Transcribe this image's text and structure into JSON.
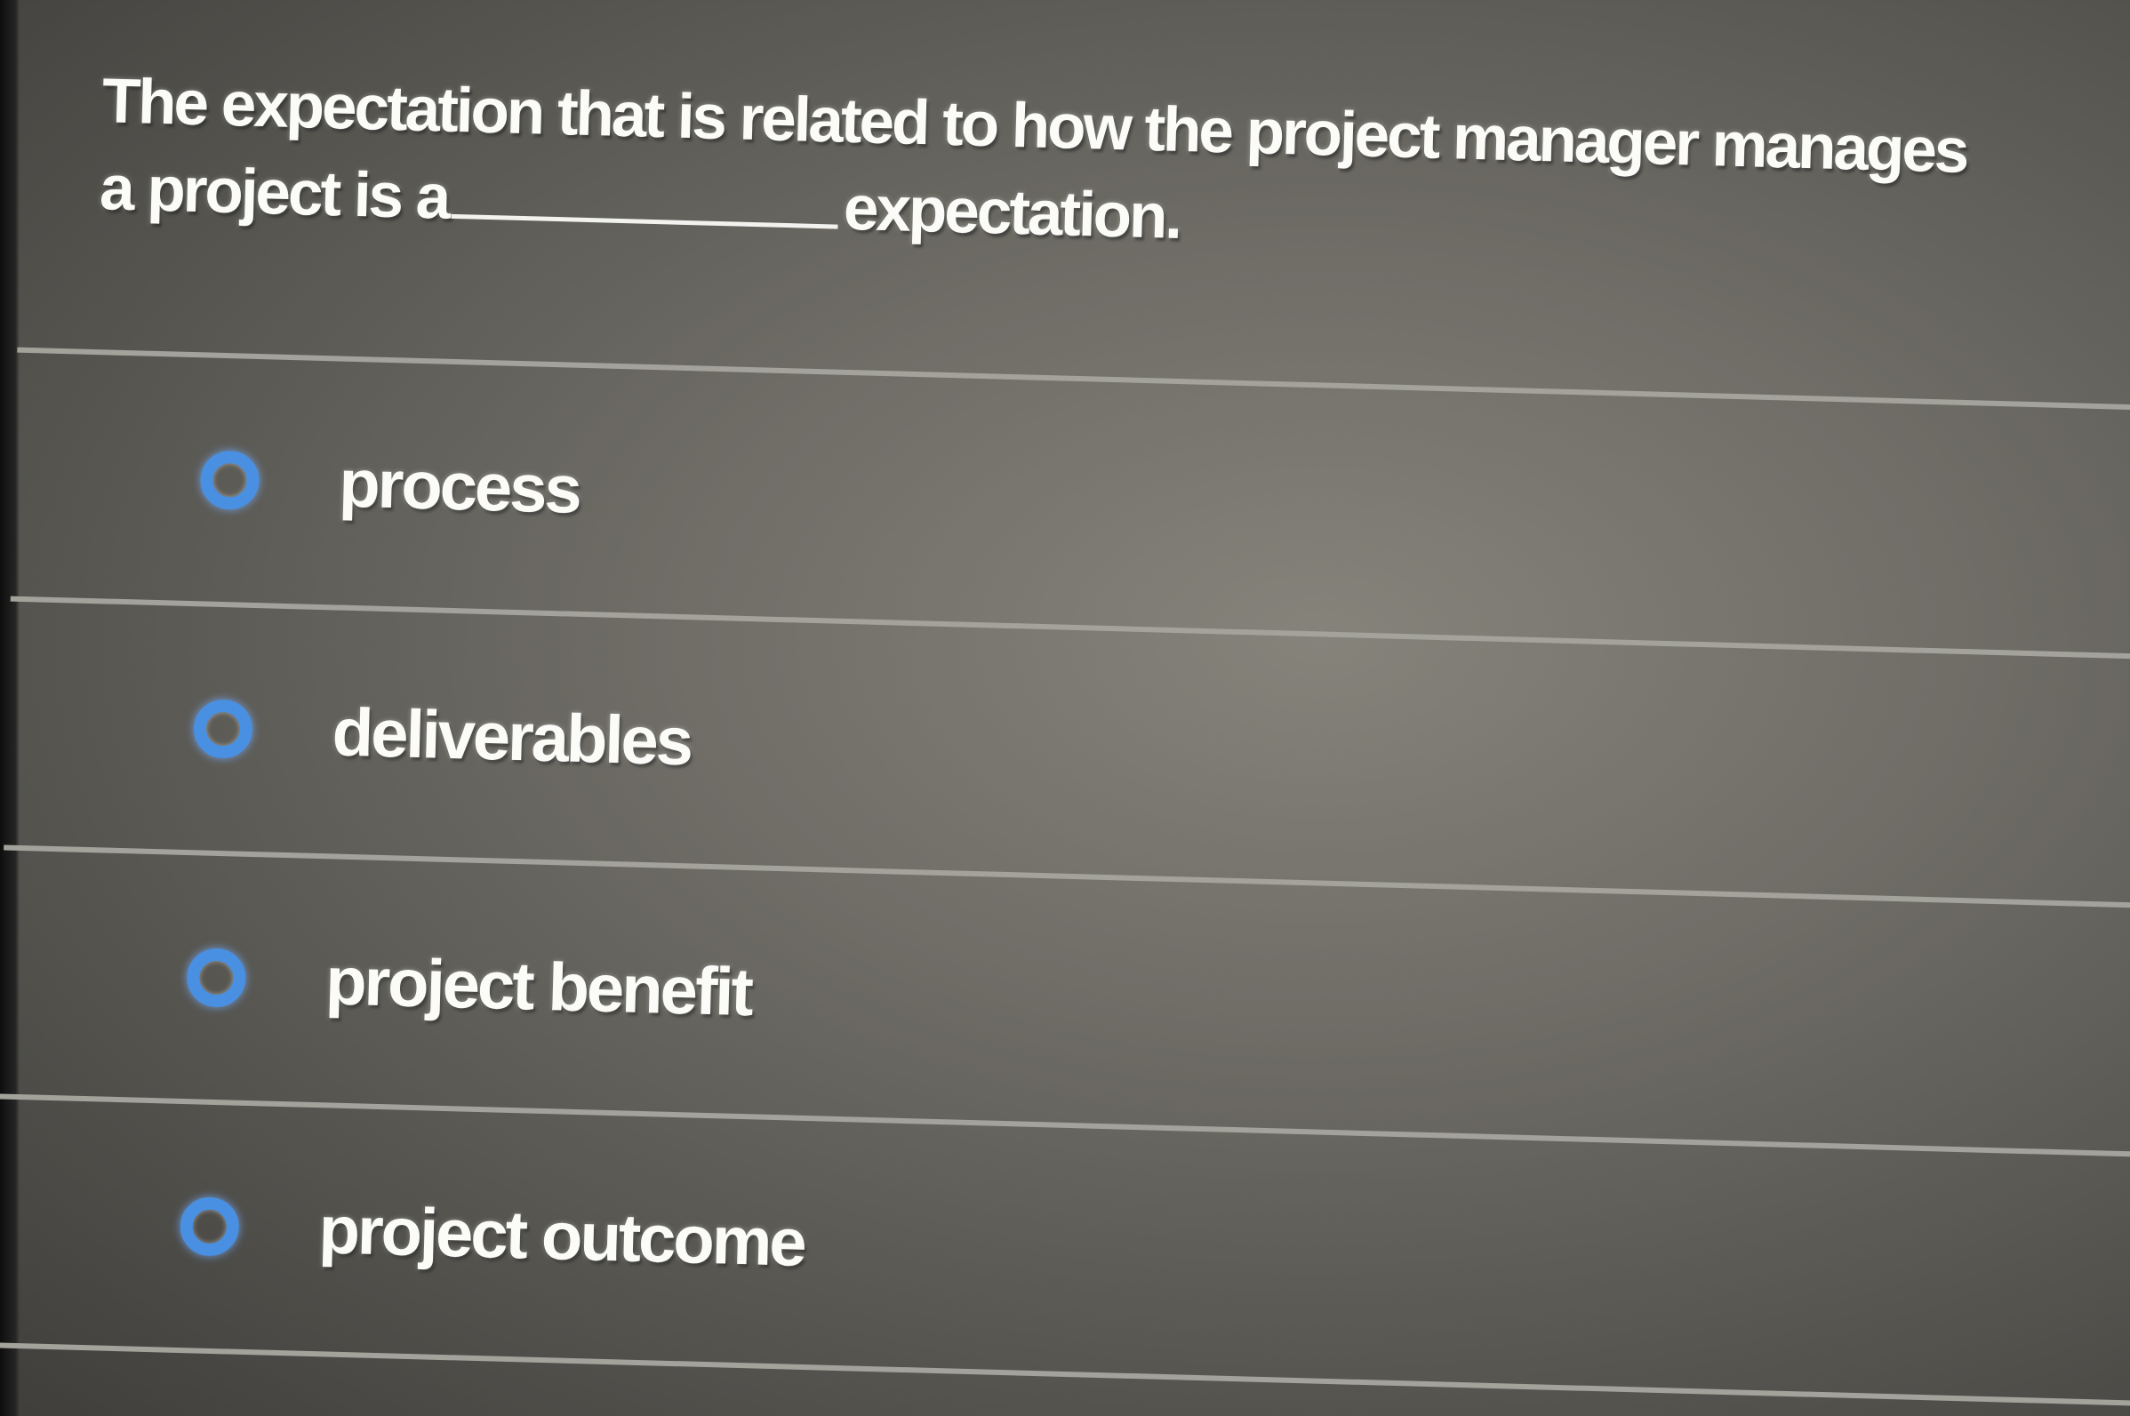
{
  "question": {
    "line1": "The expectation that is related to how the project manager manages",
    "line2_before": "a project is a",
    "line2_after": "expectation."
  },
  "options": [
    {
      "label": "process",
      "selected": false
    },
    {
      "label": "deliverables",
      "selected": false
    },
    {
      "label": "project benefit",
      "selected": false
    },
    {
      "label": "project outcome",
      "selected": false
    }
  ],
  "colors": {
    "radio_accent": "#4a90e2",
    "background": "#6f6d66",
    "text": "#fbfbf8",
    "divider": "#a3a29b"
  }
}
